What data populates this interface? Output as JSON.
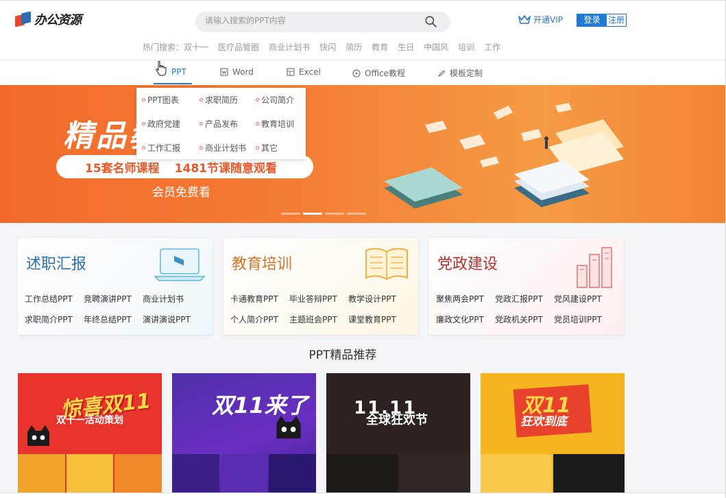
{
  "header": {
    "logo_text": "办公资源",
    "search_placeholder": "请输入搜索的PPT内容",
    "vip_label": "开通VIP",
    "login_label": "登录",
    "register_label": "注册",
    "hot_label": "热门搜索：",
    "hot_terms": [
      "双十一",
      "医疗品管圈",
      "商业计划书",
      "快闪",
      "简历",
      "教育",
      "生日",
      "中国风",
      "培训",
      "工作"
    ]
  },
  "nav": {
    "items": [
      {
        "label": "PPT",
        "icon": "ppt-icon",
        "active": true
      },
      {
        "label": "Word",
        "icon": "word-icon"
      },
      {
        "label": "Excel",
        "icon": "excel-icon"
      },
      {
        "label": "Office教程",
        "icon": "play-icon"
      },
      {
        "label": "模板定制",
        "icon": "brush-icon"
      }
    ]
  },
  "dropdown": {
    "items": [
      "PPT图表",
      "求职简历",
      "公司简介",
      "政府党建",
      "产品发布",
      "教育培训",
      "工作汇报",
      "商业计划书",
      "其它"
    ]
  },
  "banner": {
    "title": "精品教",
    "pill_left": "15套名师课程",
    "pill_right": "1481节课随意观看",
    "sub": "会员免费看",
    "slides": 4,
    "active_slide": 2
  },
  "categories": [
    {
      "title": "述职汇报",
      "links": [
        "工作总结PPT",
        "竞聘演讲PPT",
        "商业计划书",
        "求职简介PPT",
        "年终总结PPT",
        "演讲演说PPT"
      ]
    },
    {
      "title": "教育培训",
      "links": [
        "卡通教育PPT",
        "毕业答辩PPT",
        "教学设计PPT",
        "个人简介PPT",
        "主题班会PPT",
        "课堂教育PPT"
      ]
    },
    {
      "title": "党政建设",
      "links": [
        "聚焦两会PPT",
        "党政汇报PPT",
        "党风建设PPT",
        "廉政文化PPT",
        "党政机关PPT",
        "党员培训PPT"
      ]
    }
  ],
  "section_title": "PPT精品推荐",
  "thumbnails": [
    {
      "headline": "惊喜双11",
      "sub": "双十一活动策划"
    },
    {
      "headline": "双11来了"
    },
    {
      "headline": "11.11",
      "sub": "全球狂欢节"
    },
    {
      "headline": "双11",
      "sub": "狂欢到底"
    }
  ],
  "colors": {
    "brand_blue": "#1f7ad6",
    "banner_orange": "#f26a2a"
  }
}
